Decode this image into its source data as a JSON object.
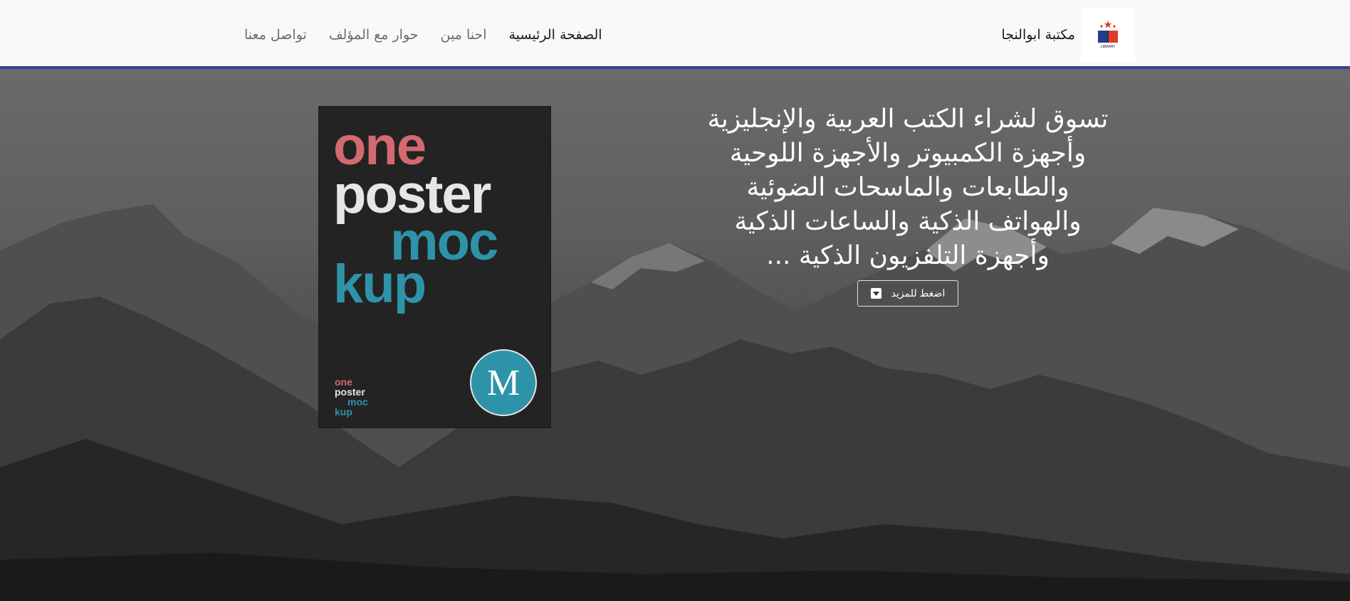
{
  "navbar": {
    "brand_name": "مكتبة ابوالنجا",
    "logo_text": "LIBRARY",
    "links": [
      {
        "label": "الصفحة الرئيسية",
        "active": true
      },
      {
        "label": "احنا مين",
        "active": false
      },
      {
        "label": "حوار مع المؤلف",
        "active": false
      },
      {
        "label": "تواصل معنا",
        "active": false
      }
    ]
  },
  "hero": {
    "headline_lines": [
      "تسوق لشراء الكتب العربية والإنجليزية",
      "وأجهزة الكمبيوتر والأجهزة اللوحية",
      "والطابعات والماسحات الضوئية",
      "والهواتف الذكية والساعات الذكية",
      "وأجهزة التلفزيون الذكية ..."
    ],
    "more_button_label": "اضغط للمزيد",
    "more_button_icon": "caret-down-icon"
  },
  "poster": {
    "words": [
      "one",
      "poster",
      "moc",
      "kup"
    ],
    "mini_words": [
      "one",
      "poster",
      "moc",
      "kup"
    ],
    "badge_letter": "M"
  },
  "colors": {
    "navbar_bg": "#f8f9fb",
    "navbar_border": "#3b3f8f",
    "poster_bg": "#232323",
    "poster_red": "#d26a6f",
    "poster_teal": "#2e93a8"
  }
}
